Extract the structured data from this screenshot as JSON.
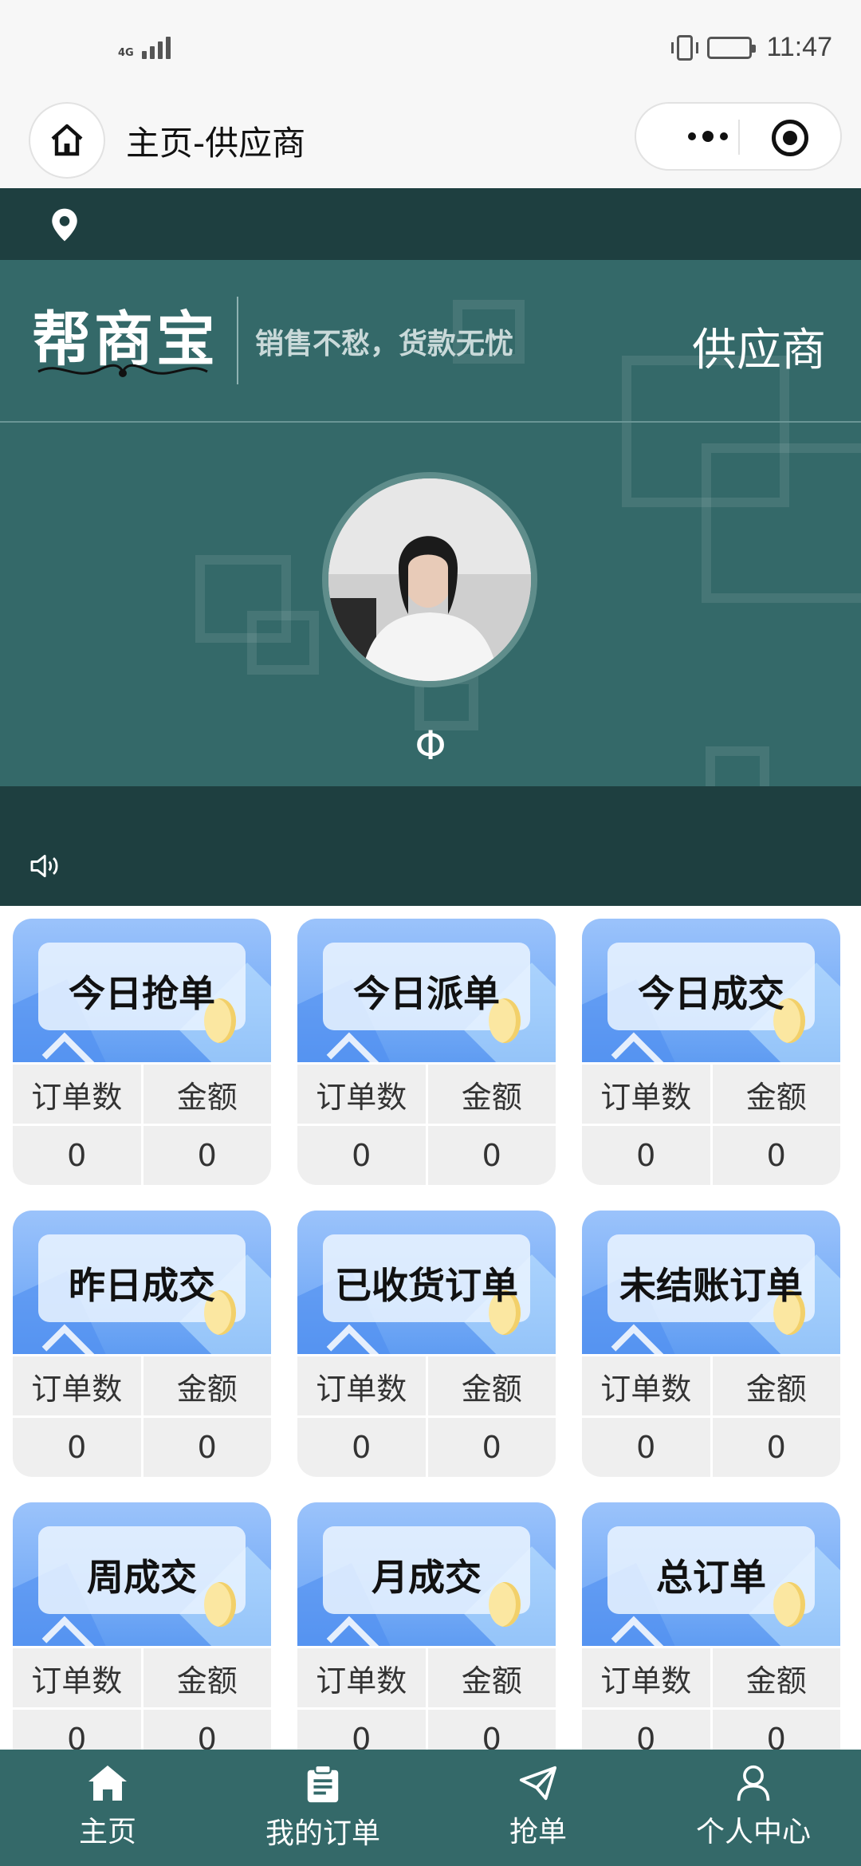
{
  "status_bar": {
    "network": "4G",
    "time": "11:47"
  },
  "nav": {
    "title": "主页-供应商"
  },
  "banner": {
    "logo": "帮商宝",
    "slogan": "销售不愁，货款无忧",
    "role": "供应商",
    "username": "Φ"
  },
  "cards": [
    {
      "title": "今日抢单",
      "col1": "订单数",
      "col2": "金额",
      "count": "0",
      "amount": "0"
    },
    {
      "title": "今日派单",
      "col1": "订单数",
      "col2": "金额",
      "count": "0",
      "amount": "0"
    },
    {
      "title": "今日成交",
      "col1": "订单数",
      "col2": "金额",
      "count": "0",
      "amount": "0"
    },
    {
      "title": "昨日成交",
      "col1": "订单数",
      "col2": "金额",
      "count": "0",
      "amount": "0"
    },
    {
      "title": "已收货订单",
      "col1": "订单数",
      "col2": "金额",
      "count": "0",
      "amount": "0"
    },
    {
      "title": "未结账订单",
      "col1": "订单数",
      "col2": "金额",
      "count": "0",
      "amount": "0"
    },
    {
      "title": "周成交",
      "col1": "订单数",
      "col2": "金额",
      "count": "0",
      "amount": "0"
    },
    {
      "title": "月成交",
      "col1": "订单数",
      "col2": "金额",
      "count": "0",
      "amount": "0"
    },
    {
      "title": "总订单",
      "col1": "订单数",
      "col2": "金额",
      "count": "0",
      "amount": "0"
    }
  ],
  "tabs": [
    {
      "label": "主页",
      "icon": "home-icon"
    },
    {
      "label": "我的订单",
      "icon": "clipboard-icon"
    },
    {
      "label": "抢单",
      "icon": "paper-plane-icon"
    },
    {
      "label": "个人中心",
      "icon": "user-icon"
    }
  ],
  "colors": {
    "primary": "#346969",
    "dark": "#1e3f40",
    "card_blue": "#7aaef7"
  }
}
